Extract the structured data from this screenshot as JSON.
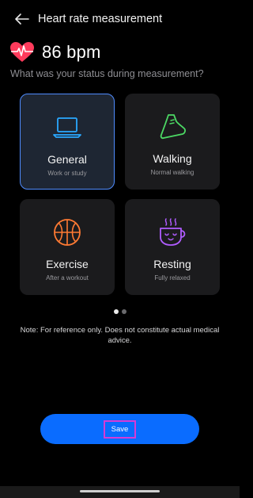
{
  "header": {
    "title": "Heart rate measurement"
  },
  "measurement": {
    "bpm_text": "86 bpm"
  },
  "prompt": {
    "question": "What was your status during measurement?"
  },
  "status_options": [
    {
      "label": "General",
      "sub": "Work or study",
      "icon": "laptop-icon",
      "selected": true
    },
    {
      "label": "Walking",
      "sub": "Normal walking",
      "icon": "shoe-icon",
      "selected": false
    },
    {
      "label": "Exercise",
      "sub": "After a workout",
      "icon": "basketball-icon",
      "selected": false
    },
    {
      "label": "Resting",
      "sub": "Fully relaxed",
      "icon": "coffee-cup-icon",
      "selected": false
    }
  ],
  "pager": {
    "pages": 2,
    "current": 1
  },
  "note": "Note: For reference only. Does not constitute actual medical advice.",
  "actions": {
    "save_label": "Save"
  },
  "colors": {
    "accent": "#0a6cff",
    "selected_border": "#4f8cff",
    "heart": "#ff3b5c",
    "walking": "#4cd964",
    "exercise": "#ff7a33",
    "resting": "#b05cff",
    "general": "#2aa8ff"
  }
}
